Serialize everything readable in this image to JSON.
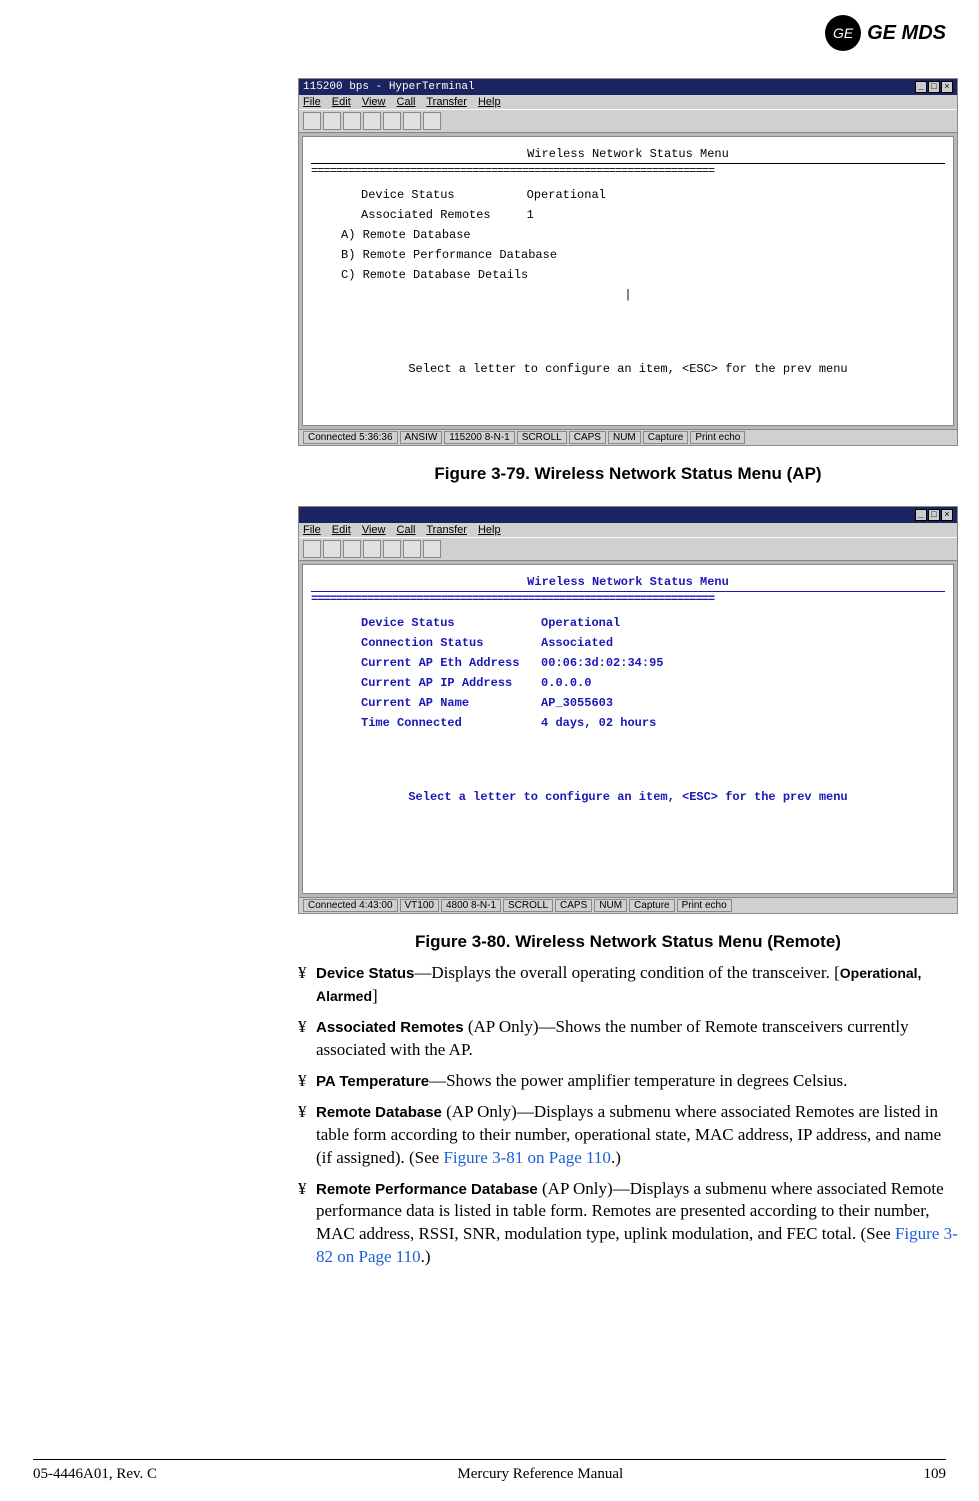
{
  "header": {
    "brand": "GE MDS",
    "badge": "GE"
  },
  "term1": {
    "windowTitle": "115200 bps - HyperTerminal",
    "menus": [
      "File",
      "Edit",
      "View",
      "Call",
      "Transfer",
      "Help"
    ],
    "title": "Wireless Network Status Menu",
    "rows": [
      {
        "label": "Device Status",
        "value": "Operational"
      },
      {
        "label": "Associated Remotes",
        "value": "1"
      }
    ],
    "options": [
      "A) Remote Database",
      "B) Remote Performance Database",
      "C) Remote Database Details"
    ],
    "footer": "Select a letter to configure an item, <ESC> for the prev menu",
    "status": [
      "Connected 5:36:36",
      "ANSIW",
      "115200 8-N-1",
      "SCROLL",
      "CAPS",
      "NUM",
      "Capture",
      "Print echo"
    ]
  },
  "caption1": "Figure 3-79. Wireless Network Status Menu (AP)",
  "term2": {
    "windowTitle": "",
    "menus": [
      "File",
      "Edit",
      "View",
      "Call",
      "Transfer",
      "Help"
    ],
    "title": "Wireless Network Status Menu",
    "rows": [
      {
        "label": "Device Status",
        "value": "Operational"
      },
      {
        "label": "Connection Status",
        "value": "Associated"
      },
      {
        "label": "Current AP Eth Address",
        "value": "00:06:3d:02:34:95"
      },
      {
        "label": "Current AP IP Address",
        "value": "0.0.0.0"
      },
      {
        "label": "Current AP Name",
        "value": "AP_3055603"
      },
      {
        "label": "Time Connected",
        "value": "4 days, 02 hours"
      }
    ],
    "footer": "Select a letter to configure an item, <ESC> for the prev menu",
    "status": [
      "Connected 4:43:00",
      "VT100",
      "4800 8-N-1",
      "SCROLL",
      "CAPS",
      "NUM",
      "Capture",
      "Print echo"
    ]
  },
  "caption2": "Figure 3-80. Wireless Network Status Menu (Remote)",
  "defs": [
    {
      "term": "Device Status",
      "qual": "",
      "dash": "—",
      "text1": "Displays the overall operating condition of the transceiver. [",
      "opt": "Operational, Alarmed",
      "text2": "]"
    },
    {
      "term": "Associated Remotes",
      "qual": " (AP Only)",
      "dash": "—",
      "text1": "Shows the number of Remote transceivers currently associated with the AP.",
      "opt": "",
      "text2": ""
    },
    {
      "term": "PA Temperature",
      "qual": "",
      "dash": "—",
      "text1": "Shows the power amplifier temperature in degrees Celsius.",
      "opt": "",
      "text2": ""
    },
    {
      "term": "Remote Database",
      "qual": " (AP Only)",
      "dash": "—",
      "text1": "Displays a submenu where associated Remotes are listed in table form according to their number, operational state, MAC address, IP address, and name (if assigned). (See ",
      "link": "Figure 3-81 on Page 110",
      "text2": ".)"
    },
    {
      "term": "Remote Performance Database",
      "qual": " (AP Only)",
      "dash": "—",
      "text1": "Displays a submenu where associated Remote performance data is listed in table form. Remotes are presented according to their number, MAC address, RSSI, SNR, modulation type, uplink modulation, and FEC total. (See ",
      "link": "Figure 3-82 on Page 110",
      "text2": ".)"
    }
  ],
  "footer": {
    "left": "05-4446A01, Rev. C",
    "center": "Mercury Reference Manual",
    "right": "109"
  }
}
